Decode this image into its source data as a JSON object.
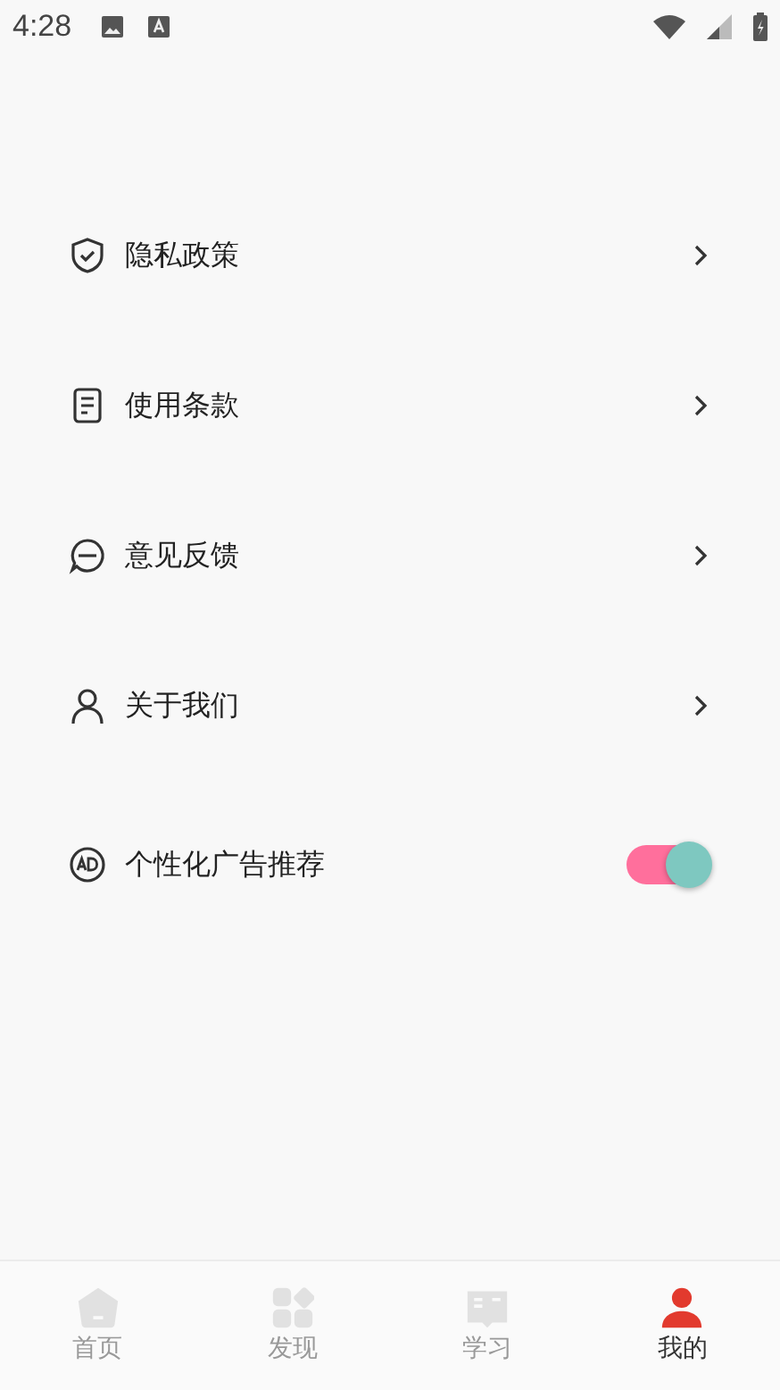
{
  "status_bar": {
    "time": "4:28"
  },
  "menu": [
    {
      "kind": "link",
      "label": "隐私政策"
    },
    {
      "kind": "link",
      "label": "使用条款"
    },
    {
      "kind": "link",
      "label": "意见反馈"
    },
    {
      "kind": "link",
      "label": "关于我们"
    },
    {
      "kind": "toggle",
      "label": "个性化广告推荐",
      "on": true
    }
  ],
  "tabs": [
    {
      "label": "首页",
      "selected": false
    },
    {
      "label": "发现",
      "selected": false
    },
    {
      "label": "学习",
      "selected": false
    },
    {
      "label": "我的",
      "selected": true
    }
  ]
}
